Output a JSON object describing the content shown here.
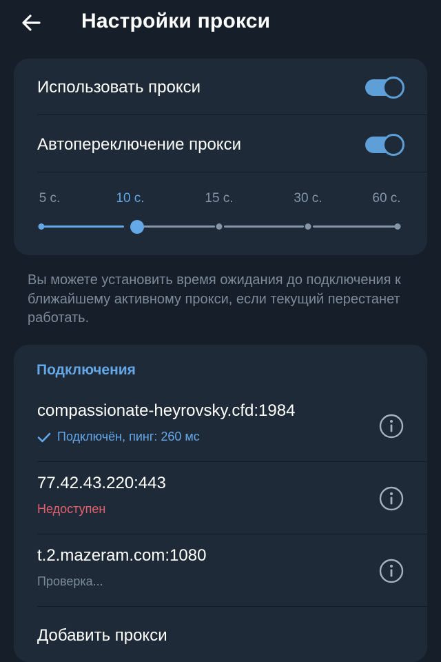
{
  "header": {
    "title": "Настройки прокси",
    "back_icon": "arrow-left-icon"
  },
  "settings": {
    "use_proxy": {
      "label": "Использовать прокси",
      "enabled": true
    },
    "auto_switch": {
      "label": "Автопереключение прокси",
      "enabled": true
    }
  },
  "timeout_slider": {
    "options": [
      "5 с.",
      "10 с.",
      "15 с.",
      "30 с.",
      "60 с."
    ],
    "selected": "10 с."
  },
  "hint": "Вы можете установить время ожидания до подключения к ближайшему активному прокси, если текущий перестанет работать.",
  "connections": {
    "title": "Подключения",
    "items": [
      {
        "host": "compassionate-heyrovsky.cfd:1984",
        "status": "Подключён, пинг: 260 мс",
        "state": "connected"
      },
      {
        "host": "77.42.43.220:443",
        "status": "Недоступен",
        "state": "unavailable"
      },
      {
        "host": "t.2.mazeram.com:1080",
        "status": "Проверка...",
        "state": "checking"
      }
    ],
    "add_label": "Добавить прокси"
  },
  "colors": {
    "background": "#151e29",
    "card": "#1e2a37",
    "accent": "#64a8e8",
    "error": "#e5606c",
    "muted": "#7d8b99"
  }
}
